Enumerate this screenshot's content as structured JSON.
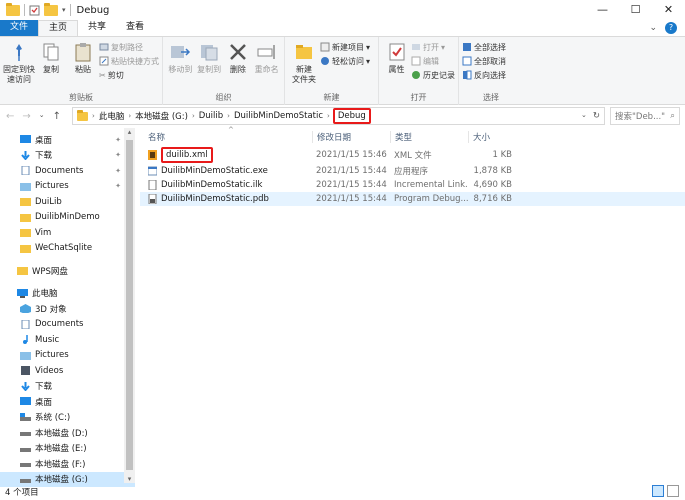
{
  "window": {
    "title": "Debug",
    "controls": [
      "—",
      "☐",
      "✕"
    ]
  },
  "ribbon_tabs": [
    "文件",
    "主页",
    "共享",
    "查看"
  ],
  "ribbon": {
    "clipboard": {
      "label": "剪贴板",
      "pin": "固定到快\n速访问",
      "copy": "复制",
      "paste": "粘贴",
      "copy_path": "复制路径",
      "paste_shortcut": "粘贴快捷方式",
      "cut": "剪切"
    },
    "organize": {
      "label": "组织",
      "move_to": "移动到",
      "copy_to": "复制到",
      "delete": "删除",
      "rename": "重命名"
    },
    "new": {
      "label": "新建",
      "new_folder": "新建\n文件夹",
      "new_item": "新建项目",
      "easy_access": "轻松访问"
    },
    "open": {
      "label": "打开",
      "properties": "属性",
      "open": "打开",
      "edit": "编辑",
      "history": "历史记录"
    },
    "select": {
      "label": "选择",
      "select_all": "全部选择",
      "select_none": "全部取消",
      "invert": "反向选择"
    }
  },
  "address": {
    "crumbs": [
      "此电脑",
      "本地磁盘 (G:)",
      "Duilib",
      "DuilibMinDemoStatic",
      "Debug"
    ],
    "search_placeholder": "搜索\"Deb...\""
  },
  "nav_pane": {
    "quick_access": [
      {
        "label": "桌面",
        "icon": "desktop-icon",
        "pinned": true
      },
      {
        "label": "下载",
        "icon": "download-icon",
        "pinned": true
      },
      {
        "label": "Documents",
        "icon": "documents-icon",
        "pinned": true
      },
      {
        "label": "Pictures",
        "icon": "pictures-icon",
        "pinned": true
      },
      {
        "label": "DuiLib",
        "icon": "folder-icon",
        "pinned": false
      },
      {
        "label": "DuilibMinDemo",
        "icon": "folder-icon",
        "pinned": false
      },
      {
        "label": "Vim",
        "icon": "folder-icon",
        "pinned": false
      },
      {
        "label": "WeChatSqlite",
        "icon": "folder-icon",
        "pinned": false
      }
    ],
    "wps": "WPS网盘",
    "this_pc": "此电脑",
    "pc_items": [
      {
        "label": "3D 对象",
        "icon": "3d-objects-icon"
      },
      {
        "label": "Documents",
        "icon": "documents-icon"
      },
      {
        "label": "Music",
        "icon": "music-icon"
      },
      {
        "label": "Pictures",
        "icon": "pictures-icon"
      },
      {
        "label": "Videos",
        "icon": "videos-icon"
      },
      {
        "label": "下载",
        "icon": "download-icon"
      },
      {
        "label": "桌面",
        "icon": "desktop-icon"
      },
      {
        "label": "系统 (C:)",
        "icon": "system-drive-icon"
      },
      {
        "label": "本地磁盘 (D:)",
        "icon": "drive-icon"
      },
      {
        "label": "本地磁盘 (E:)",
        "icon": "drive-icon"
      },
      {
        "label": "本地磁盘 (F:)",
        "icon": "drive-icon"
      },
      {
        "label": "本地磁盘 (G:)",
        "icon": "drive-icon",
        "selected": true
      }
    ]
  },
  "file_list": {
    "columns": [
      "名称",
      "修改日期",
      "类型",
      "大小"
    ],
    "rows": [
      {
        "name": "duilib.xml",
        "date": "2021/1/15 15:46",
        "type": "XML 文件",
        "size": "1 KB",
        "icon": "xml-file-icon"
      },
      {
        "name": "DuilibMinDemoStatic.exe",
        "date": "2021/1/15 15:44",
        "type": "应用程序",
        "size": "1,878 KB",
        "icon": "exe-file-icon"
      },
      {
        "name": "DuilibMinDemoStatic.ilk",
        "date": "2021/1/15 15:44",
        "type": "Incremental Link...",
        "size": "4,690 KB",
        "icon": "ilk-file-icon"
      },
      {
        "name": "DuilibMinDemoStatic.pdb",
        "date": "2021/1/15 15:44",
        "type": "Program Debug...",
        "size": "8,716 KB",
        "icon": "pdb-file-icon"
      }
    ]
  },
  "status": {
    "count": "4 个项目"
  },
  "colors": {
    "accent": "#1979ca",
    "highlight": "#e81a1a",
    "selection": "#cce8ff"
  }
}
